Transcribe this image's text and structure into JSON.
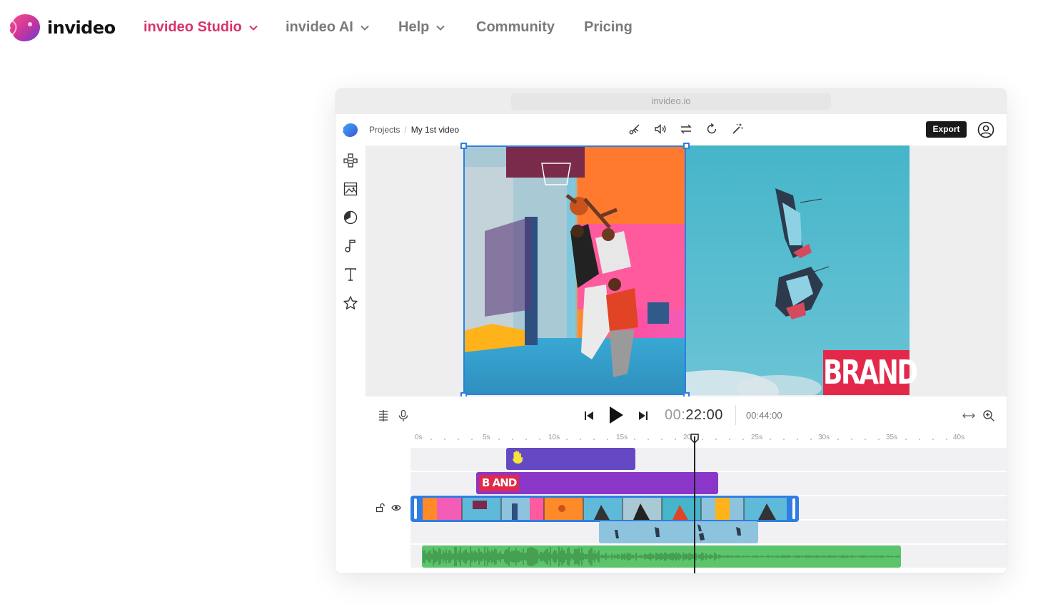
{
  "nav": {
    "logo_text": "invideo",
    "items": [
      {
        "label": "invideo Studio",
        "has_dropdown": true,
        "active": true
      },
      {
        "label": "invideo AI",
        "has_dropdown": true,
        "active": false
      },
      {
        "label": "Help",
        "has_dropdown": true,
        "active": false
      },
      {
        "label": "Community",
        "has_dropdown": false,
        "active": false
      },
      {
        "label": "Pricing",
        "has_dropdown": false,
        "active": false
      }
    ]
  },
  "editor": {
    "url": "invideo.io",
    "breadcrumb": {
      "root": "Projects",
      "separator": "/",
      "current": "My 1st video"
    },
    "toolbar_icons": [
      "scissors-icon",
      "volume-icon",
      "swap-icon",
      "rotate-icon",
      "magic-wand-icon"
    ],
    "export_label": "Export",
    "side_tools": [
      "layout-icon",
      "media-icon",
      "elements-icon",
      "music-icon",
      "text-icon",
      "favorites-icon"
    ],
    "brand_text": "BRAND",
    "brand_track_text": "B AND",
    "time_current_dim": "00:",
    "time_current_main": "22:00",
    "time_total": "00:44:00",
    "ruler_labels": [
      "0s",
      "5s",
      "10s",
      "15s",
      "20s",
      "25s",
      "30s",
      "35s",
      "40s"
    ]
  },
  "colors": {
    "accent": "#d8336d",
    "selection": "#2f7de1",
    "sticker_track": "#6549c4",
    "brand_track": "#8a37c9",
    "audio_track": "#5cc46a",
    "video_track": "#8dc3dc",
    "export_bg": "#1a1a1a"
  }
}
